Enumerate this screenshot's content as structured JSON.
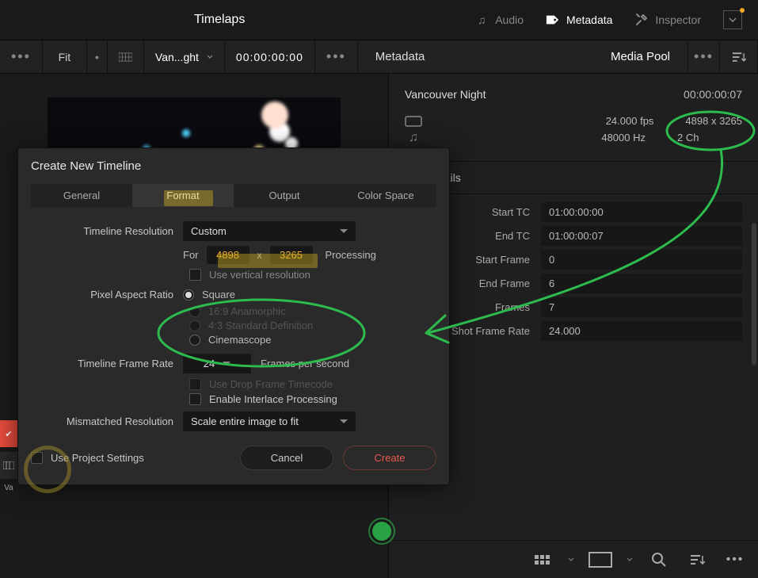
{
  "topbar": {
    "title": "Timelaps",
    "menu": {
      "audio": "Audio",
      "metadata": "Metadata",
      "inspector": "Inspector"
    }
  },
  "toolbar": {
    "fit": "Fit",
    "clip_short": "Van...ght",
    "timecode": "00:00:00:00",
    "right_title": "Metadata",
    "right_tab": "Media Pool"
  },
  "metadata": {
    "clip_name": "Vancouver Night",
    "duration": "00:00:00:07",
    "fps": "24.000 fps",
    "resolution": "4898 x 3265",
    "audio_rate": "48000 Hz",
    "channels": "2 Ch",
    "section": "Clip Details",
    "details": [
      {
        "k": "Start TC",
        "v": "01:00:00:00"
      },
      {
        "k": "End TC",
        "v": "01:00:00:07"
      },
      {
        "k": "Start Frame",
        "v": "0"
      },
      {
        "k": "End Frame",
        "v": "6"
      },
      {
        "k": "Frames",
        "v": "7"
      },
      {
        "k": "Shot Frame Rate",
        "v": "24.000"
      }
    ]
  },
  "dialog": {
    "title": "Create New Timeline",
    "tabs": [
      "General",
      "Format",
      "Output",
      "Color Space"
    ],
    "tl_res_label": "Timeline Resolution",
    "tl_res_preset": "Custom",
    "for": "For",
    "width": "4898",
    "height": "3265",
    "processing": "Processing",
    "x": "x",
    "use_vertical": "Use vertical resolution",
    "par_label": "Pixel Aspect Ratio",
    "par_options": [
      "Square",
      "16:9 Anamorphic",
      "4:3 Standard Definition",
      "Cinemascope"
    ],
    "fr_label": "Timeline Frame Rate",
    "fr_value": "24",
    "fr_suffix": "Frames per second",
    "drop_frame": "Use Drop Frame Timecode",
    "interlace": "Enable Interlace Processing",
    "mismatch_label": "Mismatched Resolution",
    "mismatch_value": "Scale entire image to fit",
    "use_project": "Use Project Settings",
    "cancel": "Cancel",
    "create": "Create"
  },
  "sidebar": {
    "va": "Va"
  }
}
